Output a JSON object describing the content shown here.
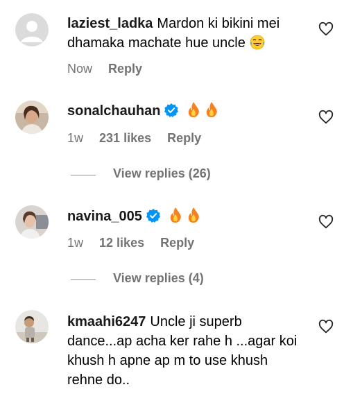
{
  "comments": [
    {
      "username": "laziest_ladka",
      "text": "Mardon ki bikini mei dhamaka machate hue uncle",
      "text_line1": "Mardon ki bikini mei",
      "text_line2": "dhamaka machate hue uncle",
      "emojis": [
        "laughing-tears-emoji"
      ],
      "time": "Now",
      "likes": "",
      "reply_label": "Reply",
      "verified": false,
      "avatar": "default-avatar"
    },
    {
      "username": "sonalchauhan",
      "text": "",
      "emojis": [
        "fire-emoji",
        "fire-emoji"
      ],
      "time": "1w",
      "likes": "231 likes",
      "reply_label": "Reply",
      "verified": true,
      "avatar": "profile-photo",
      "view_replies": "View replies (26)"
    },
    {
      "username": "navina_005",
      "text": "",
      "emojis": [
        "fire-emoji",
        "fire-emoji"
      ],
      "time": "1w",
      "likes": "12 likes",
      "reply_label": "Reply",
      "verified": true,
      "avatar": "profile-photo",
      "view_replies": "View replies (4)"
    },
    {
      "username": "kmaahi6247",
      "text": "Uncle ji superb dance...ap acha ker rahe h ...agar koi khush h apne ap m to use khush rehne do..",
      "text_line1": "Uncle ji superb",
      "text_line2": "dance...ap acha ker rahe h ...agar koi",
      "text_line3": "khush h apne ap m to use khush",
      "text_line4": "rehne do..",
      "verified": false,
      "avatar": "profile-photo"
    }
  ],
  "colors": {
    "meta_text": "#737373",
    "verified_blue": "#0095f6",
    "divider": "#8e8e8e"
  }
}
